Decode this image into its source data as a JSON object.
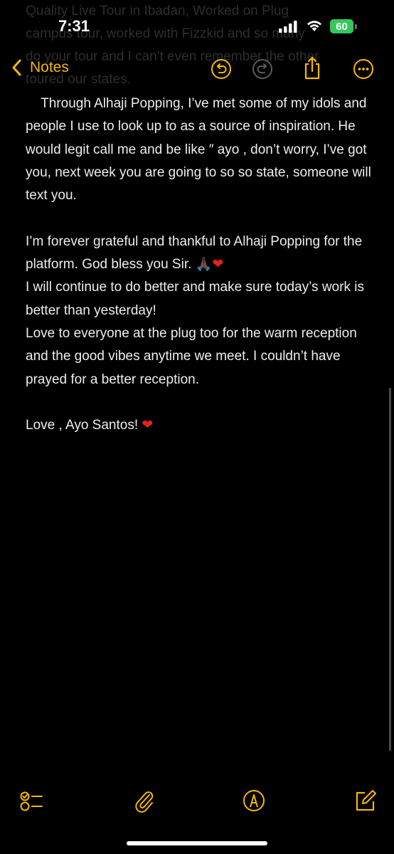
{
  "status_bar": {
    "time": "7:31",
    "battery": "60"
  },
  "background_text": "Quality Live Tour in Ibadan, Worked on Plug\ncampus tour, worked with Fizzkid and so many\ndo your tour and I can't even remember the other\ntoured our states.",
  "nav": {
    "back_label": "Notes",
    "accent_color": "#f6b800"
  },
  "note": {
    "paragraphs": [
      "    Through Alhaji Popping, I’ve met some of my idols and people I use to look up to as a source of inspiration. He would legit call me and be like ″ ayo , don’t worry, I’ve got you, next week you are going to so so state, someone will text you.",
      "",
      "I’m forever grateful and thankful to Alhaji Popping for the platform. God bless you Sir. 🙏🏿",
      "I will continue to do better and make sure today’s work is better than yesterday!",
      "Love to everyone at the plug too for the warm reception and the good vibes anytime we meet. I couldn’t have prayed for a better reception.",
      "",
      "Love , Ayo Santos! "
    ],
    "heart": "❤"
  },
  "toolbar": {
    "icons": [
      "checklist-icon",
      "attachment-icon",
      "markup-icon",
      "compose-icon"
    ]
  }
}
